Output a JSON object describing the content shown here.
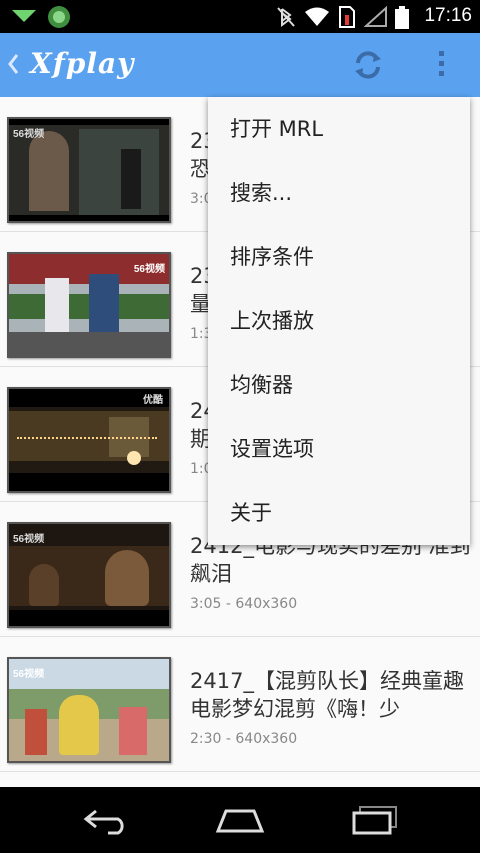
{
  "status_bar": {
    "time": "17:16",
    "icons": [
      "notification-app-icon",
      "android-icon",
      "bluetooth-off-icon",
      "wifi-icon",
      "sim-error-icon",
      "signal-icon",
      "battery-icon"
    ]
  },
  "action_bar": {
    "title": "Xfplay",
    "background": "#5aa2ef",
    "icons": [
      "back-caret-icon",
      "refresh-icon",
      "overflow-menu-icon"
    ]
  },
  "videos": [
    {
      "title": "23\n恐",
      "meta": "3:0"
    },
    {
      "title": "23\n量",
      "meta": "1:3"
    },
    {
      "title": "24\n期",
      "meta": "1:0"
    },
    {
      "title": "2412_电影与现实的差别 准到飙泪",
      "meta": "3:05 - 640x360"
    },
    {
      "title": "2417_【混剪队长】经典童趣电影梦幻混剪《嗨！少",
      "meta": "2:30 - 640x360"
    }
  ],
  "menu": {
    "items": [
      "打开 MRL",
      "搜索...",
      "排序条件",
      "上次播放",
      "均衡器",
      "设置选项",
      "关于"
    ]
  },
  "thumb_logos": [
    "56视频",
    "56视频",
    "优酷",
    "56视频",
    "56视频"
  ],
  "nav_bar": {
    "icons": [
      "back-icon",
      "home-icon",
      "recent-apps-icon"
    ]
  }
}
